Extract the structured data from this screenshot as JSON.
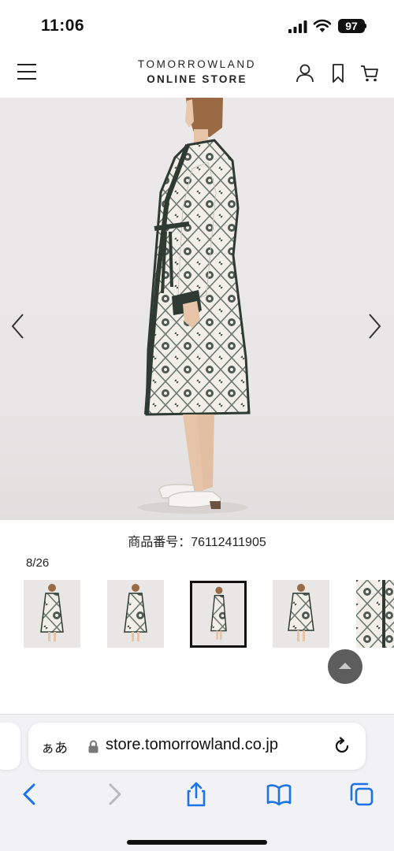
{
  "status_bar": {
    "time": "11:06",
    "battery": "97"
  },
  "header": {
    "logo_line1": "TOMORROWLAND",
    "logo_line2": "ONLINE STORE",
    "icons": [
      "menu-icon",
      "account-icon",
      "bookmark-icon",
      "cart-icon"
    ]
  },
  "product": {
    "number_label": "商品番号：76112411905",
    "image_counter": "8/26"
  },
  "browser": {
    "aa_label": "ぁあ",
    "url": "store.tomorrowland.co.jp",
    "nav_icons": [
      "back-icon",
      "forward-icon",
      "share-icon",
      "bookmarks-icon",
      "tabs-icon"
    ]
  },
  "colors": {
    "accent_blue": "#1a73e8",
    "text": "#111111",
    "hero_background": "#e9e7e7",
    "coat": "#f1efe7",
    "coat_trim": "#3a4a3f"
  }
}
